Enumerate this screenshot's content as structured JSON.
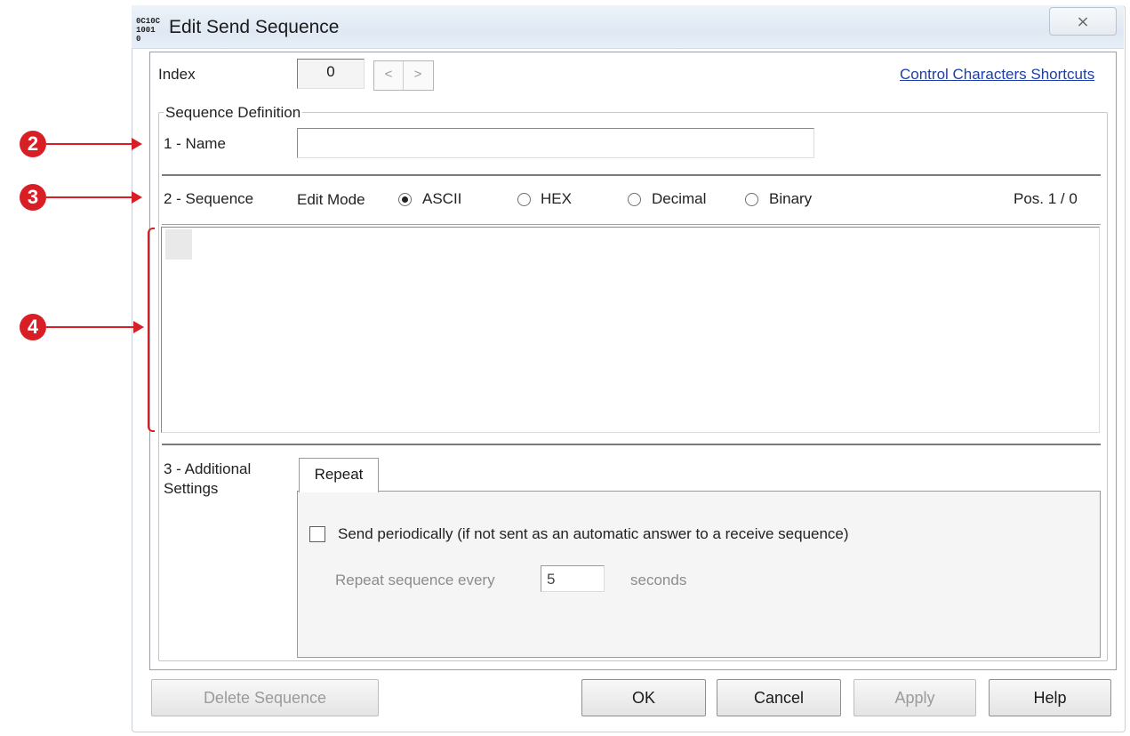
{
  "window": {
    "title": "Edit Send Sequence",
    "icon": "binary-app-icon",
    "icon_text": "0C10C\n1001 0",
    "close_glyph": "⌥"
  },
  "header": {
    "index_label": "Index",
    "index_value": "0",
    "prev_glyph": "<",
    "next_glyph": ">",
    "shortcuts_link": "Control Characters Shortcuts"
  },
  "sequence_definition": {
    "title": "Sequence Definition",
    "name_label": "1 - Name",
    "name_value": "",
    "sequence_label": "2 - Sequence",
    "edit_mode_label": "Edit Mode",
    "modes": [
      "ASCII",
      "HEX",
      "Decimal",
      "Binary"
    ],
    "selected_mode": "ASCII",
    "position": "Pos. 1 / 0"
  },
  "additional_settings": {
    "label_line1": "3 - Additional",
    "label_line2": "Settings",
    "tab": "Repeat",
    "send_periodically": "Send periodically",
    "send_periodically_note": "(if not sent as an automatic answer to a receive sequence)",
    "send_periodically_checked": false,
    "repeat_label": "Repeat sequence every",
    "repeat_value": "5",
    "repeat_unit": "seconds"
  },
  "buttons": {
    "delete": "Delete Sequence",
    "ok": "OK",
    "cancel": "Cancel",
    "apply": "Apply",
    "help": "Help"
  },
  "annotations": {
    "marker_name": "2",
    "marker_sequence": "3",
    "marker_editor": "4"
  },
  "colors": {
    "annotation": "#d81f26",
    "link": "#1d3fa6",
    "titlebar": "#dfe8f3"
  }
}
